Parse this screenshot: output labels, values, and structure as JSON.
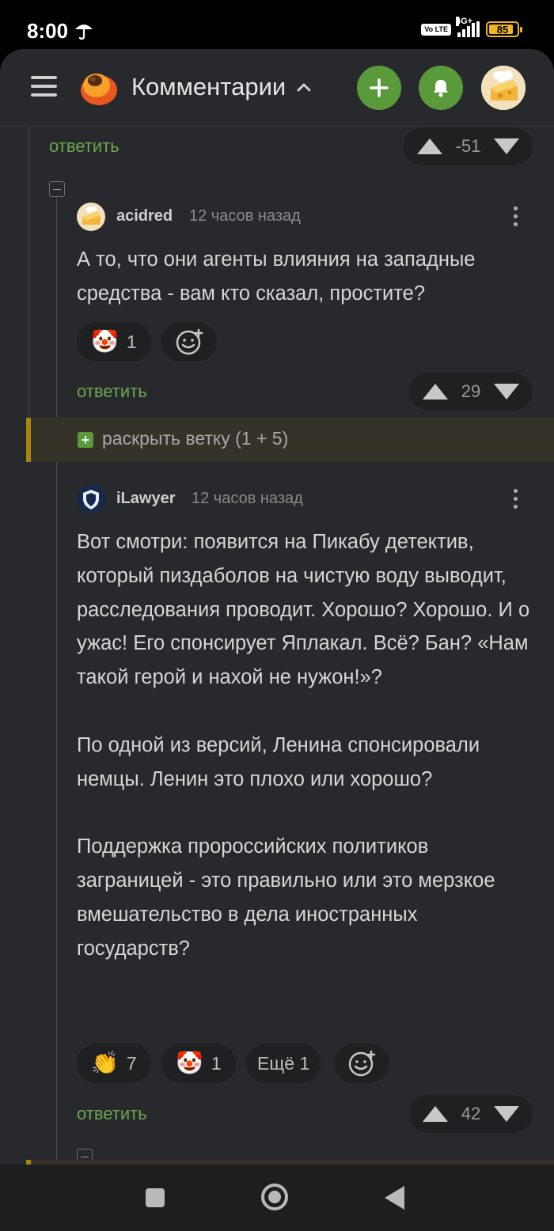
{
  "status_bar": {
    "time": "8:00",
    "network": "4G+",
    "volte": "Vo LTE",
    "battery": "85"
  },
  "header": {
    "title": "Комментарии"
  },
  "top_fragment": {
    "reply_label": "ответить",
    "score": "-51"
  },
  "comments": [
    {
      "author": "acidred",
      "time": "12 часов назад",
      "text": "А то, что они агенты влияния на западные средства - вам кто сказал, простите?",
      "reactions": [
        {
          "emoji": "🤡",
          "count": "1",
          "icon": "clown-face-icon"
        }
      ],
      "reply_label": "ответить",
      "score": "29"
    },
    {
      "author": "iLawyer",
      "time": "12 часов назад",
      "text": "Вот смотри: появится на Пикабу детектив, который пиздаболов на чистую воду выводит, расследования проводит. Хорошо? Хорошо. И о ужас! Его спонсирует Яплакал. Всё? Бан? «Нам такой герой и нахой не нужон!»?\n\nПо одной из версий, Ленина спонсировали немцы. Ленин это плохо или хорошо?\n\nПоддержка пророссийских политиков заграницей - это правильно или это мерзкое вмешательство в дела иностранных государств?",
      "reactions": [
        {
          "emoji": "👏",
          "count": "7",
          "icon": "clapping-hands-icon"
        },
        {
          "emoji": "🤡",
          "count": "1",
          "icon": "clown-face-icon"
        }
      ],
      "more_label": "Ещё 1",
      "reply_label": "ответить",
      "score": "42"
    }
  ],
  "expand_branch": {
    "label": "раскрыть ветку (1 + 5)"
  },
  "colors": {
    "accent_green": "#5a9a3b",
    "branch_bar": "#a8860d",
    "background": "#28292c"
  }
}
